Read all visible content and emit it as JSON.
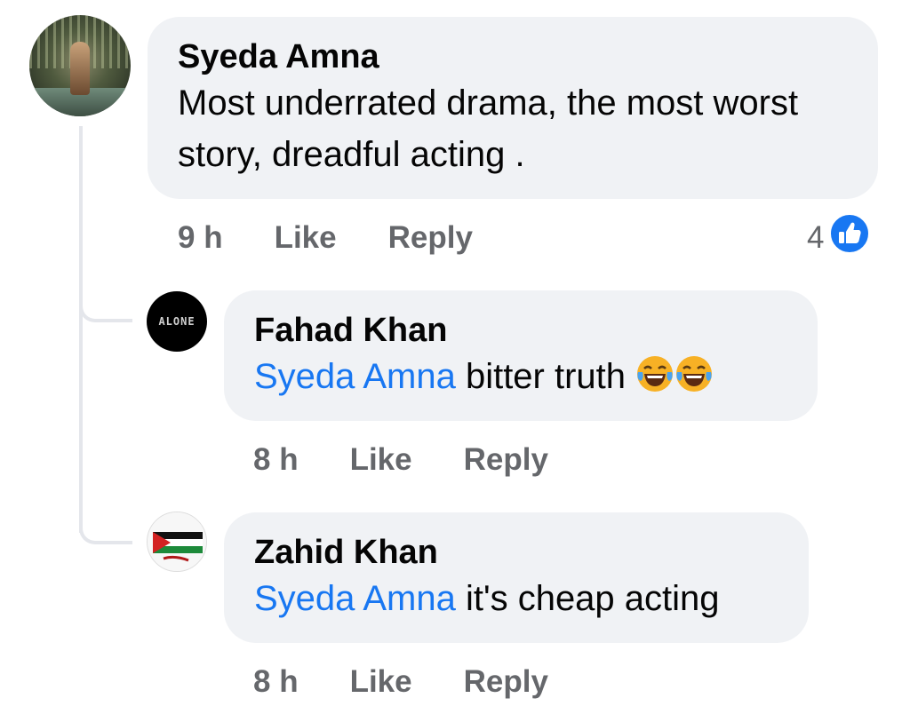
{
  "comments": [
    {
      "author": "Syeda Amna",
      "text": "Most underrated drama, the most worst story, dreadful acting .",
      "time": "9 h",
      "like_label": "Like",
      "reply_label": "Reply",
      "reaction_count": "4",
      "reaction_icon": "like-thumb-icon"
    }
  ],
  "replies": [
    {
      "author": "Fahad Khan",
      "mention": "Syeda Amna",
      "text": " bitter truth ",
      "emojis": [
        "face-with-tears-of-joy",
        "face-with-tears-of-joy"
      ],
      "time": "8 h",
      "like_label": "Like",
      "reply_label": "Reply",
      "avatar_text": "ALONE"
    },
    {
      "author": "Zahid Khan",
      "mention": "Syeda Amna",
      "text": " it's cheap acting",
      "time": "8 h",
      "like_label": "Like",
      "reply_label": "Reply",
      "avatar_icon": "palestine-flag"
    }
  ],
  "colors": {
    "bubble": "#f0f2f5",
    "mention": "#1877f2",
    "meta": "#65676b",
    "like_badge": "#1877f2"
  }
}
